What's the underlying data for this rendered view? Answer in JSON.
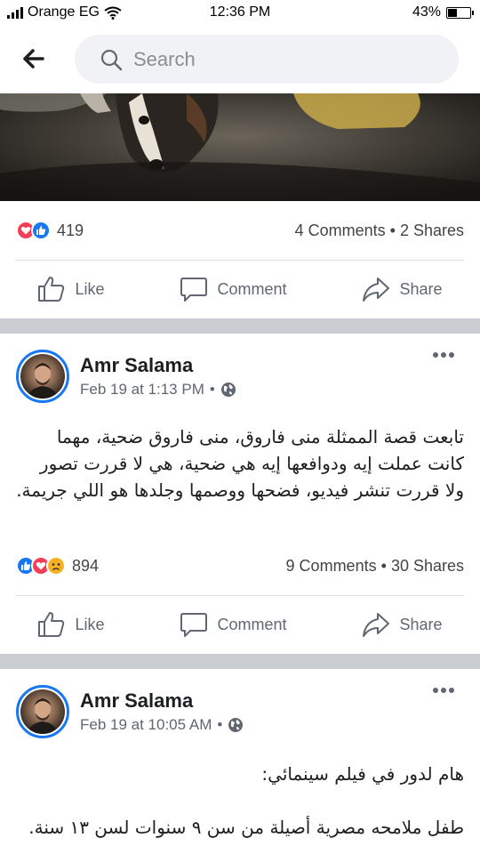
{
  "status_bar": {
    "carrier": "Orange EG",
    "time": "12:36 PM",
    "battery": "43%",
    "battery_level": 0.43
  },
  "search": {
    "placeholder": "Search"
  },
  "icons": {
    "back": "back-arrow-icon",
    "search": "search-icon",
    "more": "more-options-icon",
    "globe": "public-globe-icon",
    "like": "thumbs-up-icon",
    "comment": "comment-bubble-icon",
    "share": "share-arrow-icon"
  },
  "colors": {
    "brand": "#1877f2",
    "love": "#f33e58",
    "sad": "#f7b125",
    "separator": "#c9ccd1"
  },
  "actions": {
    "like": "Like",
    "comment": "Comment",
    "share": "Share"
  },
  "top_post": {
    "reaction_count": "419",
    "comments": "4 Comments",
    "dot": "•",
    "shares": "2 Shares"
  },
  "posts": [
    {
      "author": "Amr Salama",
      "time": "Feb 19 at 1:13 PM",
      "dot": "•",
      "text": "تابعت قصة الممثلة منى فاروق، منى فاروق ضحية، مهما كانت عملت إيه ودوافعها إيه هي ضحية، هي لا قررت تصور ولا قررت تنشر فيديو، فضحها ووصمها وجلدها هو اللي جريمة.",
      "reaction_count": "894",
      "comments": "9 Comments",
      "shares": "30 Shares"
    },
    {
      "author": "Amr Salama",
      "time": "Feb 19 at 10:05 AM",
      "dot": "•",
      "line1": "هام لدور في فيلم سينمائي:",
      "line2": "طفل ملامحه مصرية أصيلة من سن ٩ سنوات لسن ١٣ سنة."
    }
  ]
}
